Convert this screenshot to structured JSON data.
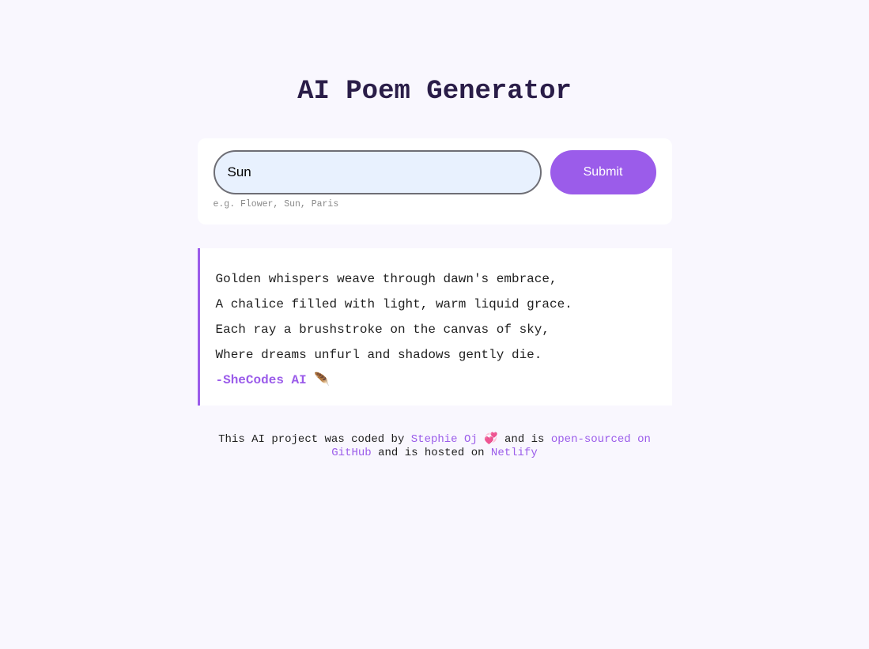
{
  "header": {
    "title": "AI Poem Generator"
  },
  "form": {
    "input_value": "Sun",
    "submit_label": "Submit",
    "hint": "e.g. Flower, Sun, Paris"
  },
  "poem": {
    "lines": [
      "Golden whispers weave through dawn's embrace,",
      "A chalice filled with light, warm liquid grace.",
      "Each ray a brushstroke on the canvas of sky,",
      "Where dreams unfurl and shadows gently die."
    ],
    "signature": "-SheCodes AI",
    "signature_emoji": "🪶"
  },
  "footer": {
    "text_1": "This AI project was coded by",
    "author_link": "Stephie Oj",
    "heart_emoji": "💞",
    "text_2": "and is",
    "github_link": "open-sourced on GitHub",
    "text_3": "and is hosted on",
    "netlify_link": "Netlify"
  },
  "colors": {
    "accent": "#9b5cea",
    "background": "#f9f7fe",
    "title": "#2a1d48",
    "input_background": "#e8f1fe"
  }
}
